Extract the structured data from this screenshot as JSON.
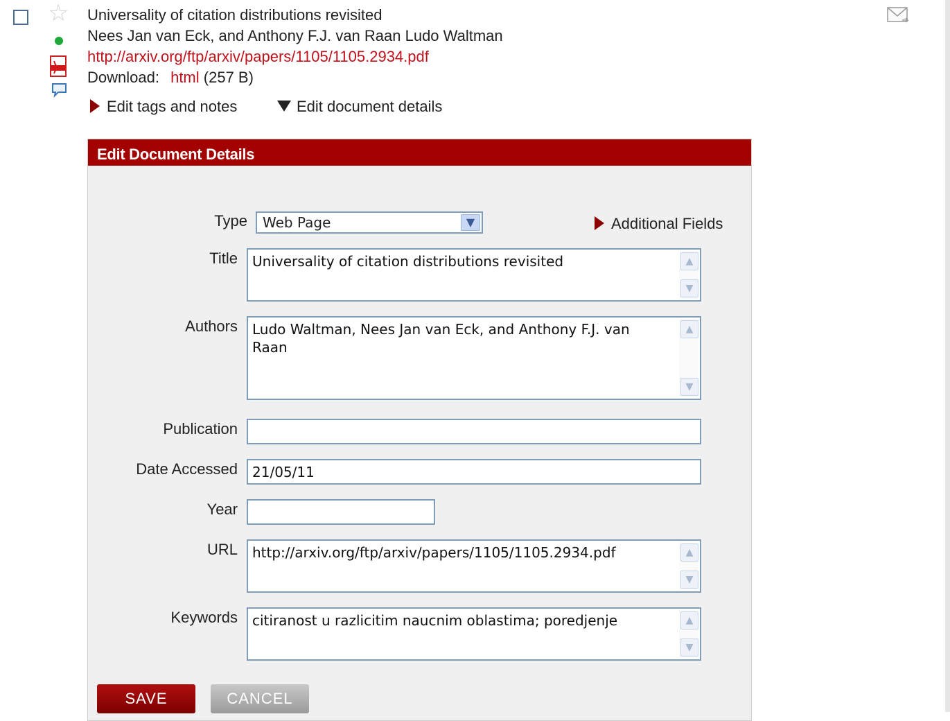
{
  "document": {
    "title": "Universality of citation distributions revisited",
    "authors_line": "Nees Jan van Eck, and Anthony F.J. van Raan Ludo Waltman",
    "url": "http://arxiv.org/ftp/arxiv/papers/1105/1105.2934.pdf",
    "download_label": "Download:",
    "download_link": "html",
    "download_size": "(257 B)"
  },
  "toggles": {
    "edit_tags": "Edit tags and notes",
    "edit_details": "Edit document details"
  },
  "panel": {
    "header": "Edit Document Details",
    "additional_fields": "Additional Fields",
    "labels": {
      "type": "Type",
      "title": "Title",
      "authors": "Authors",
      "publication": "Publication",
      "date_accessed": "Date Accessed",
      "year": "Year",
      "url": "URL",
      "keywords": "Keywords"
    },
    "values": {
      "type": "Web Page",
      "title": "Universality of citation distributions revisited",
      "authors": "Ludo Waltman, Nees Jan van Eck, and Anthony F.J. van Raan",
      "publication": "",
      "date_accessed": "21/05/11",
      "year": "",
      "url": "http://arxiv.org/ftp/arxiv/papers/1105/1105.2934.pdf",
      "keywords": "citiranost u razlicitim naucnim oblastima; poredjenje"
    },
    "buttons": {
      "save": "SAVE",
      "cancel": "CANCEL"
    }
  },
  "icons": {
    "checkbox": "checkbox-icon",
    "star": "star-icon",
    "status": "status-dot-icon",
    "pdf": "pdf-icon",
    "note": "note-icon",
    "mail": "email-icon"
  },
  "colors": {
    "accent": "#a30000",
    "link": "#c1121b",
    "status": "#1fa83a"
  }
}
